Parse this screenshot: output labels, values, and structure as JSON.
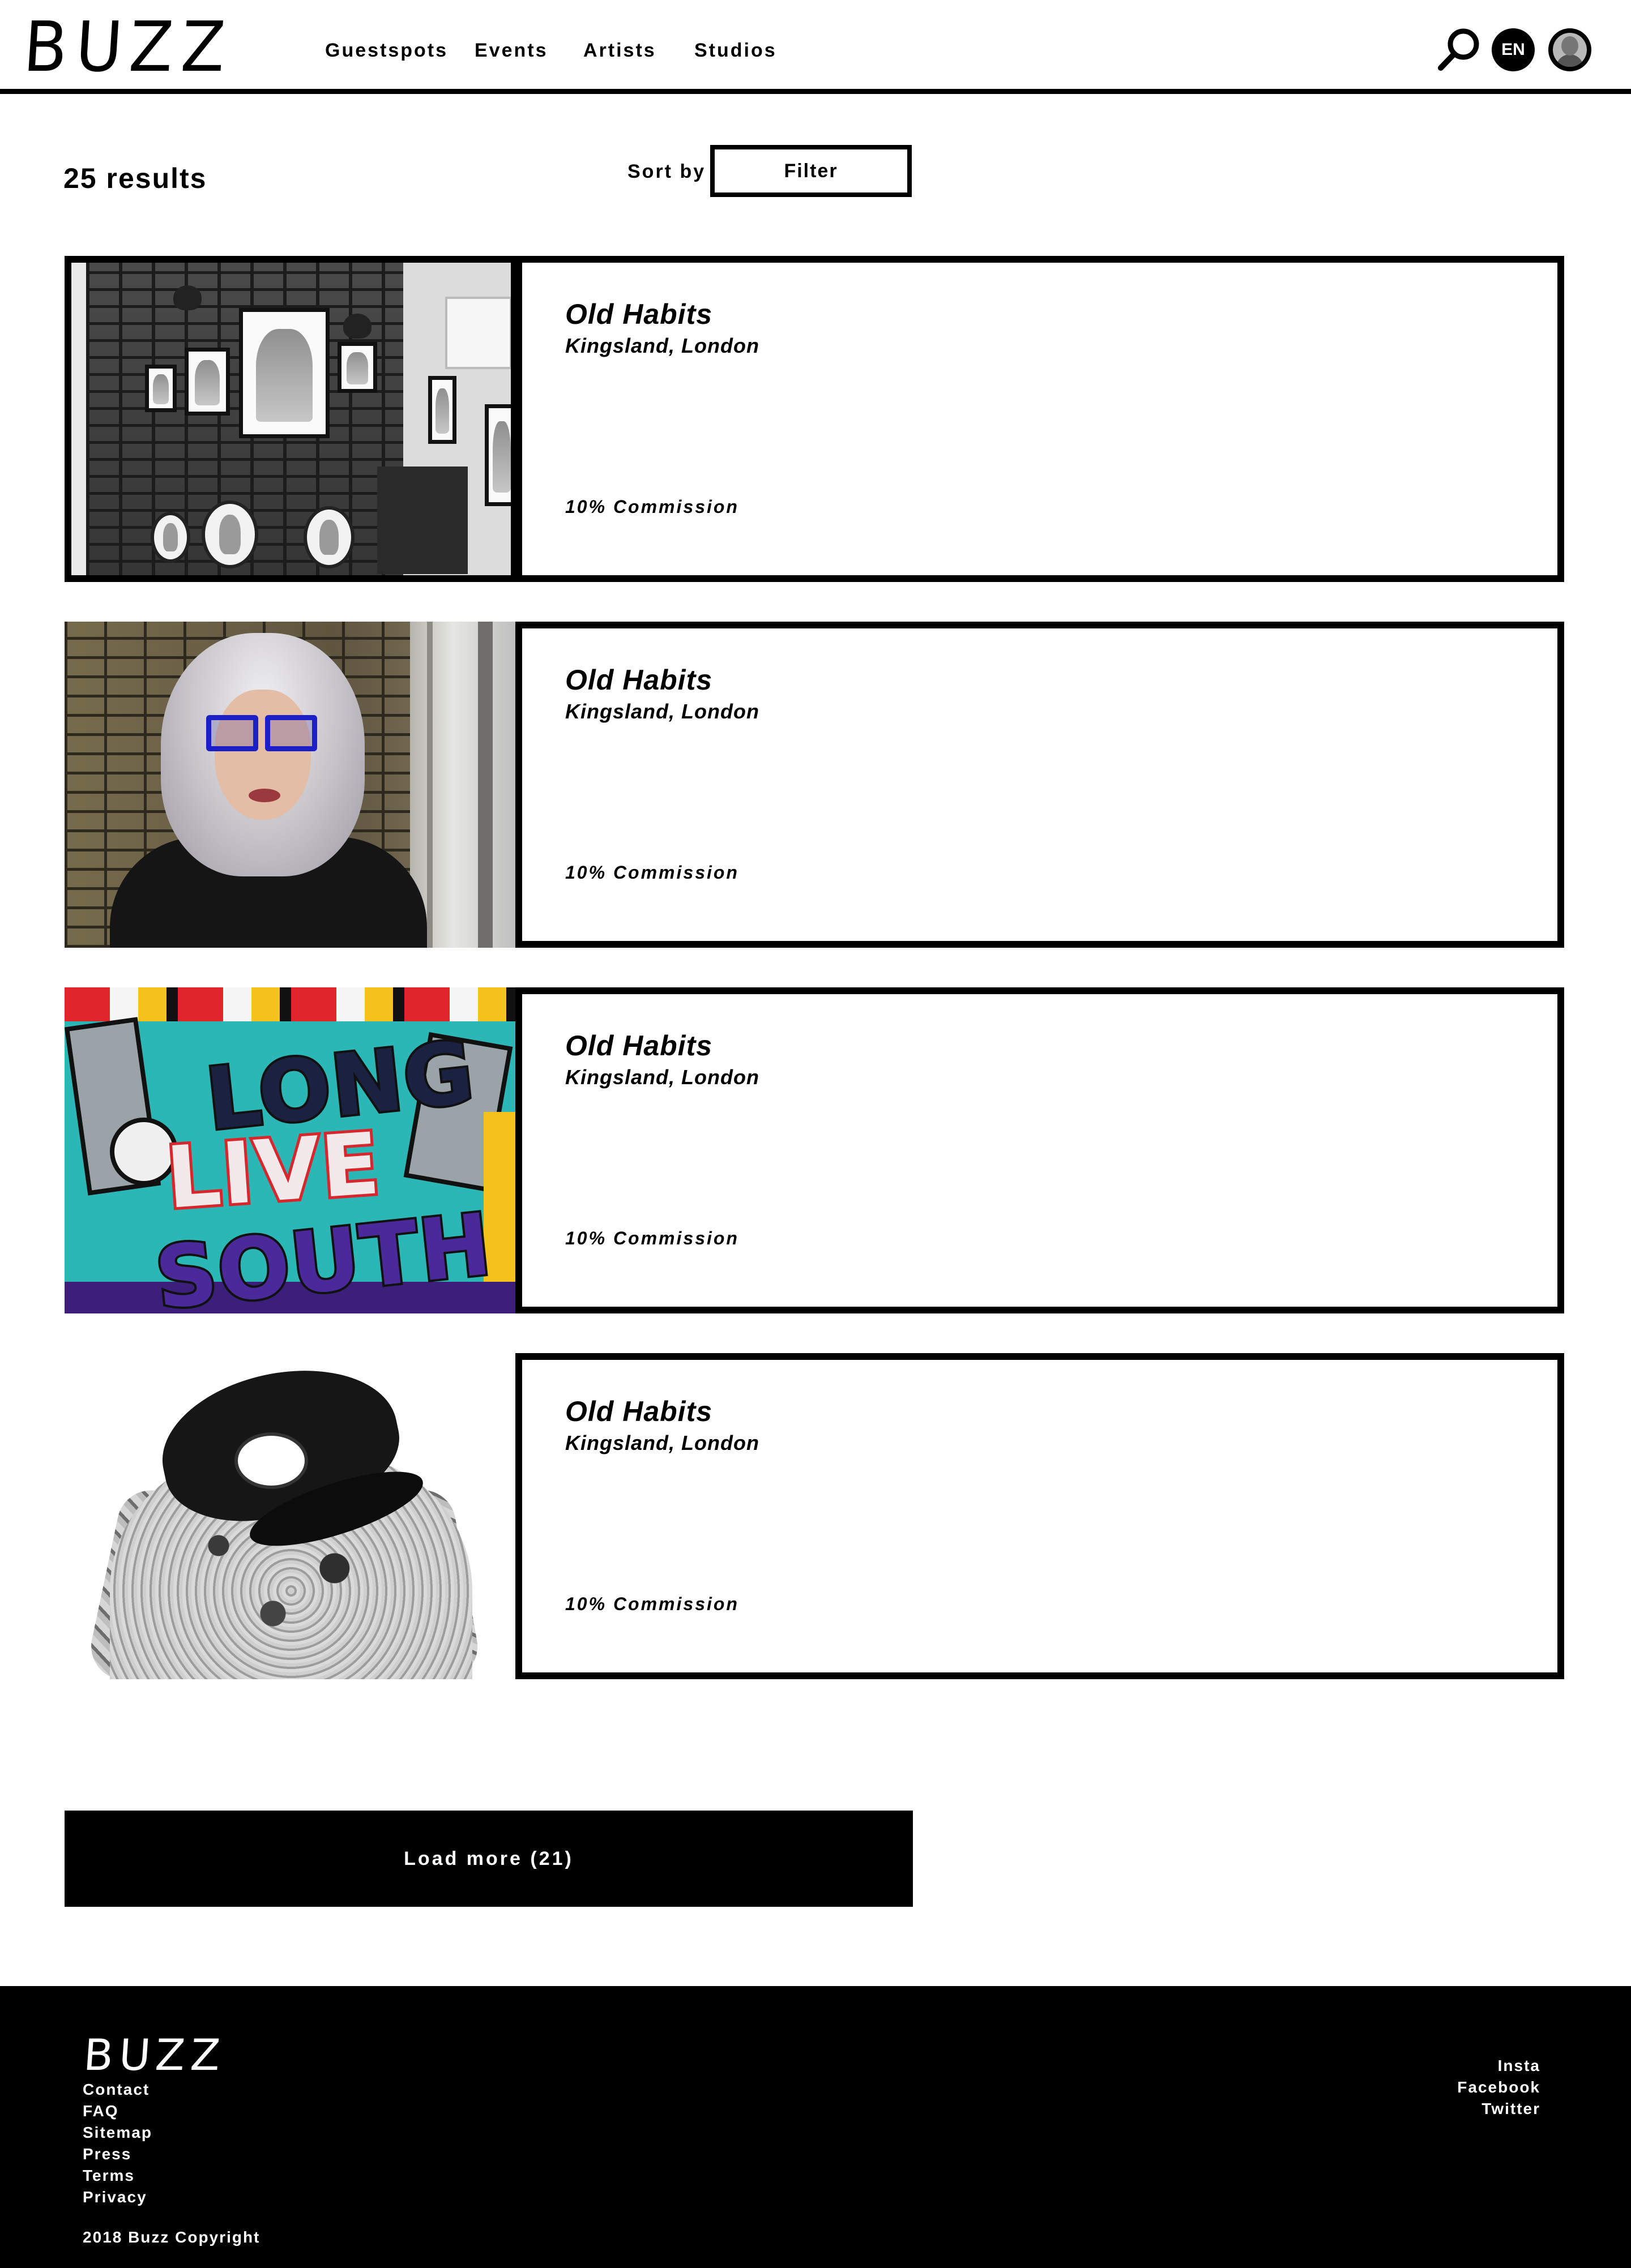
{
  "header": {
    "logo": "BUZZ",
    "nav": [
      "Guestspots",
      "Events",
      "Artists",
      "Studios"
    ],
    "lang": "EN"
  },
  "results": {
    "count_label": "25 results",
    "sort_label": "Sort by",
    "filter_label": "Filter"
  },
  "cards": [
    {
      "title": "Old Habits",
      "location": "Kingsland, London",
      "commission": "10% Commission"
    },
    {
      "title": "Old Habits",
      "location": "Kingsland, London",
      "commission": "10% Commission"
    },
    {
      "title": "Old Habits",
      "location": "Kingsland, London",
      "commission": "10% Commission"
    },
    {
      "title": "Old Habits",
      "location": "Kingsland, London",
      "commission": "10% Commission"
    }
  ],
  "graffiti": {
    "line1": "LONG",
    "line2": "LIVE",
    "line3": "SOUTH"
  },
  "load_more": "Load more (21)",
  "footer": {
    "logo": "BUZZ",
    "links": [
      "Contact",
      "FAQ",
      "Sitemap",
      "Press",
      "Terms",
      "Privacy"
    ],
    "social": [
      "Insta",
      "Facebook",
      "Twitter"
    ],
    "copyright": "2018 Buzz Copyright"
  }
}
